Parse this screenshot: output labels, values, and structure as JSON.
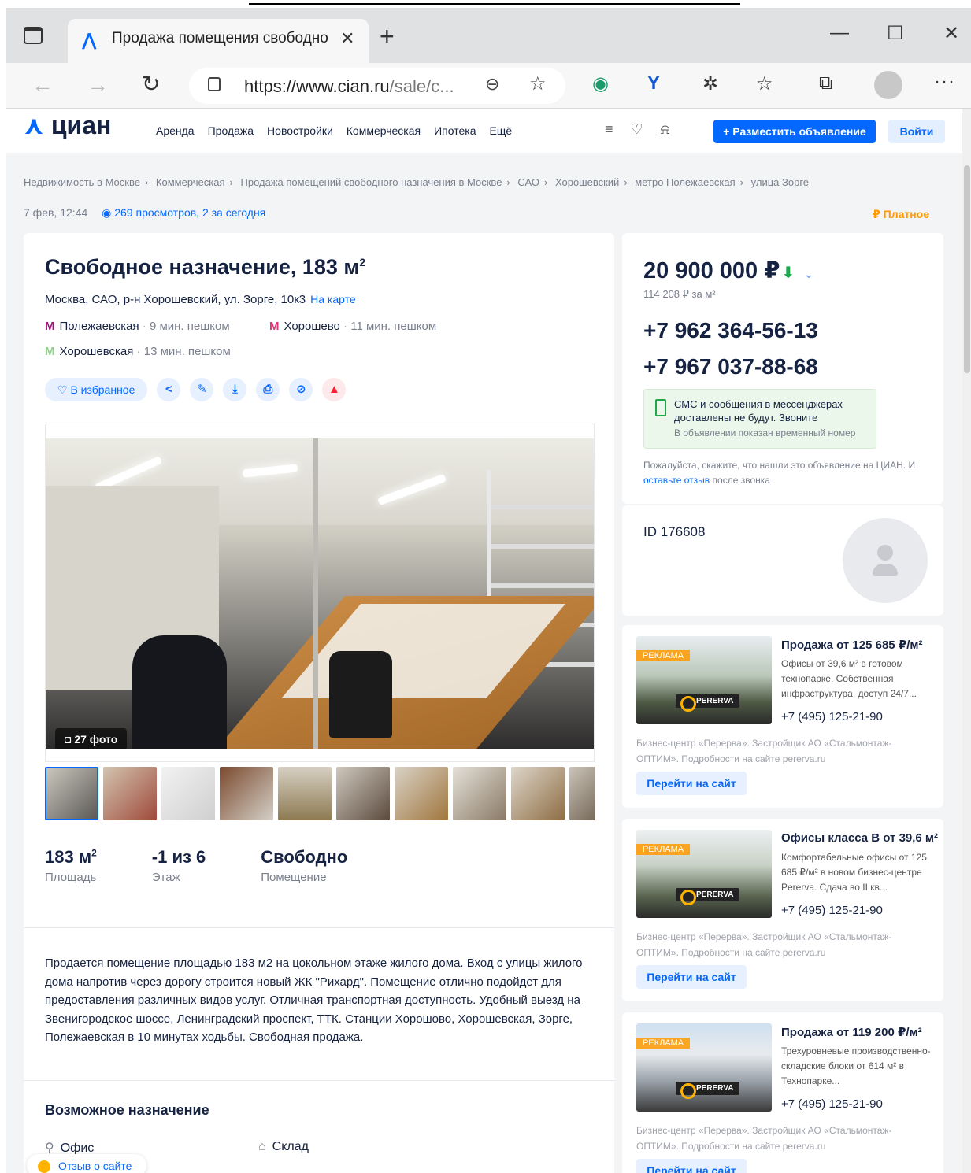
{
  "browser": {
    "tab_title": "Продажа помещения свободно",
    "url_host": "https://www.cian.ru",
    "url_path": "/sale/c...",
    "new_tab": "+",
    "tab_close": "✕"
  },
  "site": {
    "logo": "циан",
    "menu": [
      "Аренда",
      "Продажа",
      "Новостройки",
      "Коммерческая",
      "Ипотека",
      "Ещё"
    ],
    "place_ad": "+ Разместить объявление",
    "login": "Войти"
  },
  "breadcrumbs": [
    "Недвижимость в Москве",
    "Коммерческая",
    "Продажа помещений свободного назначения в Москве",
    "САО",
    "Хорошевский",
    "метро Полежаевская",
    "улица Зорге"
  ],
  "meta": {
    "date": "7 фев, 12:44",
    "views": "269 просмотров, 2 за сегодня",
    "paid": "₽  Платное"
  },
  "listing": {
    "title": "Свободное назначение, 183 м",
    "title_sup": "2",
    "address": "Москва, САО, р-н Хорошевский, ул. Зорге, 10к3",
    "map_link": "На карте",
    "metro": [
      {
        "name": "Полежаевская",
        "walk": " · 9 мин. пешком",
        "color": "#a0157a"
      },
      {
        "name": "Хорошево",
        "walk": " · 11 мин. пешком",
        "color": "#e4347a"
      },
      {
        "name": "Хорошевская",
        "walk": " · 13 мин. пешком",
        "color": "#8fd18b"
      }
    ],
    "favorite": "♡  В избранное",
    "photo_count": "◘  27 фото",
    "facts": [
      {
        "value": "183 м",
        "sup": "2",
        "label": "Площадь"
      },
      {
        "value": "-1 из 6",
        "sup": "",
        "label": "Этаж"
      },
      {
        "value": "Свободно",
        "sup": "",
        "label": "Помещение"
      }
    ],
    "description": "Продается помещение площадью 183 м2 на цокольном этаже жилого дома. Вход с улицы жилого дома напротив через дорогу строится новый ЖК \"Рихард\". Помещение отлично подойдет для предоставления различных видов услуг. Отличная транспортная доступность. Удобный выезд на Звенигородское шоссе, Ленинградский проспект, ТТК. Станции Хорошово, Хорошевская, Зорге, Полежаевская в 10 минутах ходьбы. Свободная продажа.",
    "purpose_title": "Возможное назначение",
    "purpose": [
      "Офис",
      "Склад"
    ],
    "feedback": "Отзыв о сайте"
  },
  "price": {
    "value": "20 900 000 ₽",
    "per_m2": "114 208 ₽ за м²",
    "phones": [
      "+7 962 364-56-13",
      "+7 967 037-88-68"
    ],
    "notice_main": "СМС и сообщения в мессенджерах доставлены не будут. Звоните",
    "notice_sub": "В объявлении показан временный номер",
    "ask_1": "Пожалуйста, скажите, что нашли это объявление на ЦИАН. И ",
    "ask_link": "оставьте отзыв",
    "ask_2": " после звонка"
  },
  "id": "ID 176608",
  "ads": [
    {
      "tag": "РЕКЛАМА",
      "brand": "PERERVA",
      "title": "Продажа от 125 685 ₽/м²",
      "sub": "Офисы от 39,6 м² в готовом технопарке. Собственная инфраструктура, доступ 24/7...",
      "phone": "+7 (495) 125-21-90",
      "foot": "Бизнес-центр «Перерва». Застройщик АО «Стальмонтаж-ОПТИМ». Подробности на сайте pererva.ru",
      "button": "Перейти на сайт"
    },
    {
      "tag": "РЕКЛАМА",
      "brand": "PERERVA",
      "title": "Офисы класса B от 39,6 м²",
      "sub": "Комфортабельные офисы от 125 685 ₽/м² в новом бизнес-центре Pererva. Сдача во II кв...",
      "phone": "+7 (495) 125-21-90",
      "foot": "Бизнес-центр «Перерва». Застройщик АО «Стальмонтаж-ОПТИМ». Подробности на сайте pererva.ru",
      "button": "Перейти на сайт"
    },
    {
      "tag": "РЕКЛАМА",
      "brand": "PERERVA",
      "title": "Продажа от 119 200 ₽/м²",
      "sub": "Трехуровневые производственно-складские блоки от 614 м² в Технопарке...",
      "phone": "+7 (495) 125-21-90",
      "foot": "Бизнес-центр «Перерва». Застройщик АО «Стальмонтаж-ОПТИМ». Подробности на сайте pererva.ru",
      "button": "Перейти на сайт"
    }
  ]
}
